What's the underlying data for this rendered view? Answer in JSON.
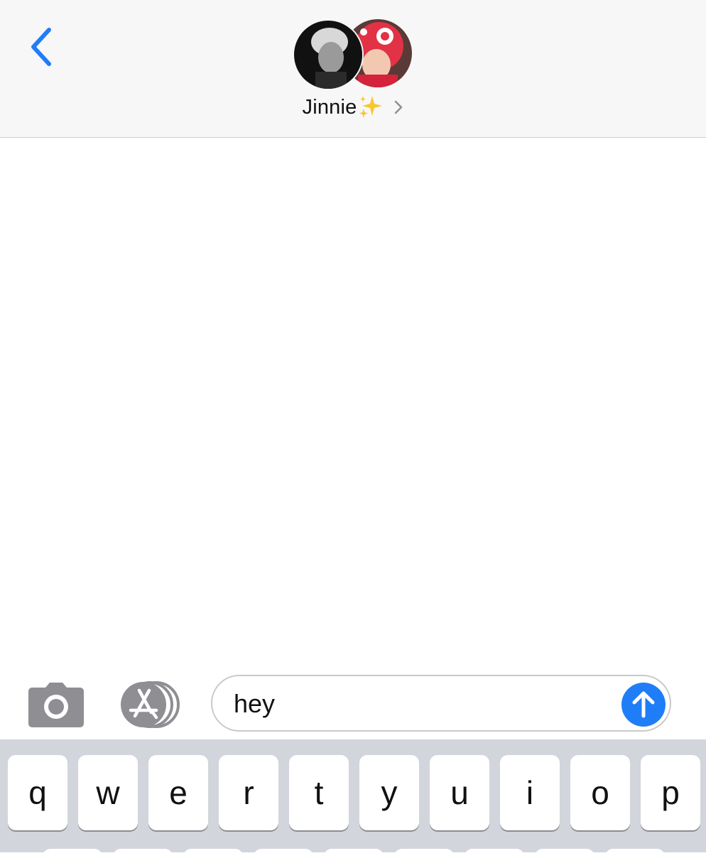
{
  "header": {
    "contact_name": "Jinnie",
    "sparkles_emoji": "✨",
    "icons": {
      "back": "chevron-left-icon",
      "details": "chevron-right-icon"
    },
    "accent_color": "#1f7ef7"
  },
  "composer": {
    "message_text": "hey",
    "icons": {
      "camera": "camera-icon",
      "apps": "app-store-icon",
      "send": "arrow-up-icon"
    },
    "send_color": "#1f7ef7"
  },
  "keyboard": {
    "top_row": [
      "q",
      "w",
      "e",
      "r",
      "t",
      "y",
      "u",
      "i",
      "o",
      "p"
    ]
  }
}
